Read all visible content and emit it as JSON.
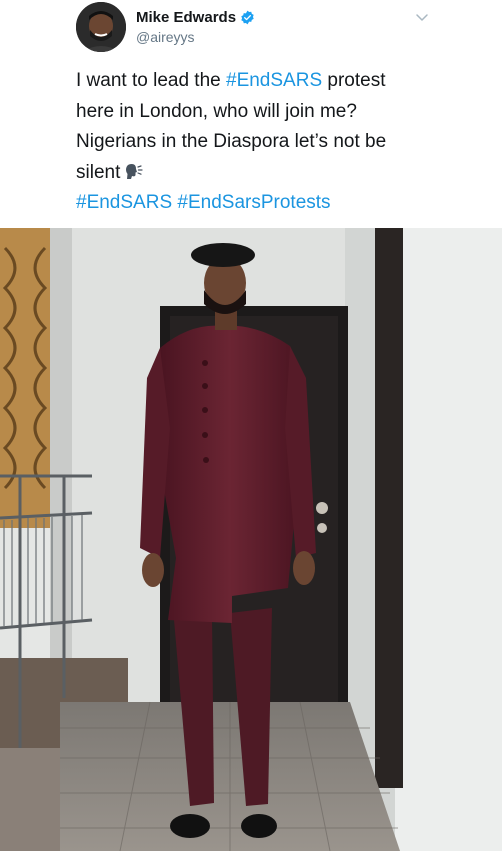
{
  "user": {
    "display_name": "Mike Edwards",
    "handle": "@aireyys",
    "verified": true,
    "avatar_icon": "avatar-photo",
    "verified_icon": "verified-badge-icon"
  },
  "menu": {
    "icon": "chevron-down-icon"
  },
  "tweet": {
    "line1_text": "I want to lead the ",
    "line1_hashtag": "#EndSARS",
    "line1_tail": " protest",
    "line2": "here in London, who will join me?",
    "line3": "Nigerians in the Diaspora let’s not be",
    "line4": "silent",
    "emoji_icon": "speaking-head-icon",
    "hashtag1": "#EndSARS",
    "hashtag2": "#EndSarsProtests"
  },
  "colors": {
    "link": "#1b95e0",
    "text": "#14171a",
    "secondary": "#657786",
    "verified": "#1da1f2",
    "suit": "#5e1f2c"
  },
  "media": {
    "icon": "photo-of-man-in-burgundy-suit"
  }
}
